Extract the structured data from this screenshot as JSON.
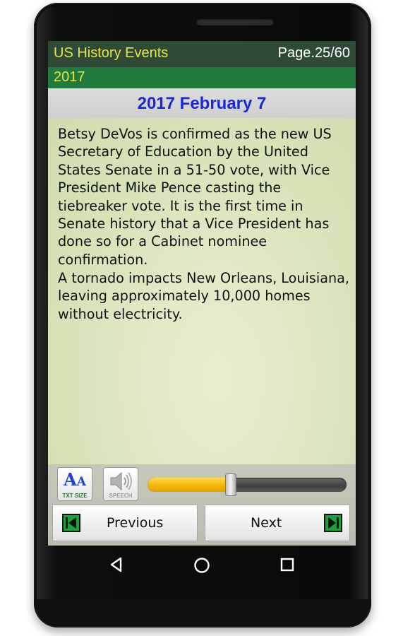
{
  "app": {
    "title": "US History Events",
    "page_indicator": "Page.25/60",
    "year": "2017",
    "date_heading": "2017 February 7"
  },
  "content": {
    "paragraphs": [
      "Betsy DeVos is confirmed as the new US Secretary of Education by the United States Senate in a 51-50 vote, with Vice President Mike Pence casting the tiebreaker vote. It is the first time in Senate history that a Vice President has done so for a Cabinet nominee confirmation.",
      "A tornado impacts New Orleans, Louisiana, leaving approximately 10,000 homes without electricity."
    ]
  },
  "controls": {
    "text_size": {
      "glyph_big": "A",
      "glyph_small": "A",
      "caption": "TXT SIZE",
      "icon": "text-size-icon"
    },
    "speech": {
      "caption": "SPEECH",
      "icon": "speaker-icon",
      "enabled": false
    },
    "slider": {
      "value": 0.42
    },
    "previous_label": "Previous",
    "next_label": "Next"
  },
  "system_nav": {
    "back_icon": "back-triangle-icon",
    "home_icon": "home-circle-icon",
    "recents_icon": "recents-square-icon"
  },
  "colors": {
    "appbar_bg": "#2f4a37",
    "title_text": "#e4e447",
    "year_bar_bg": "#1f7a3b",
    "date_text": "#1a27d6",
    "slider_fill": "#f2b400",
    "nav_icon_green": "#1aa13d"
  }
}
